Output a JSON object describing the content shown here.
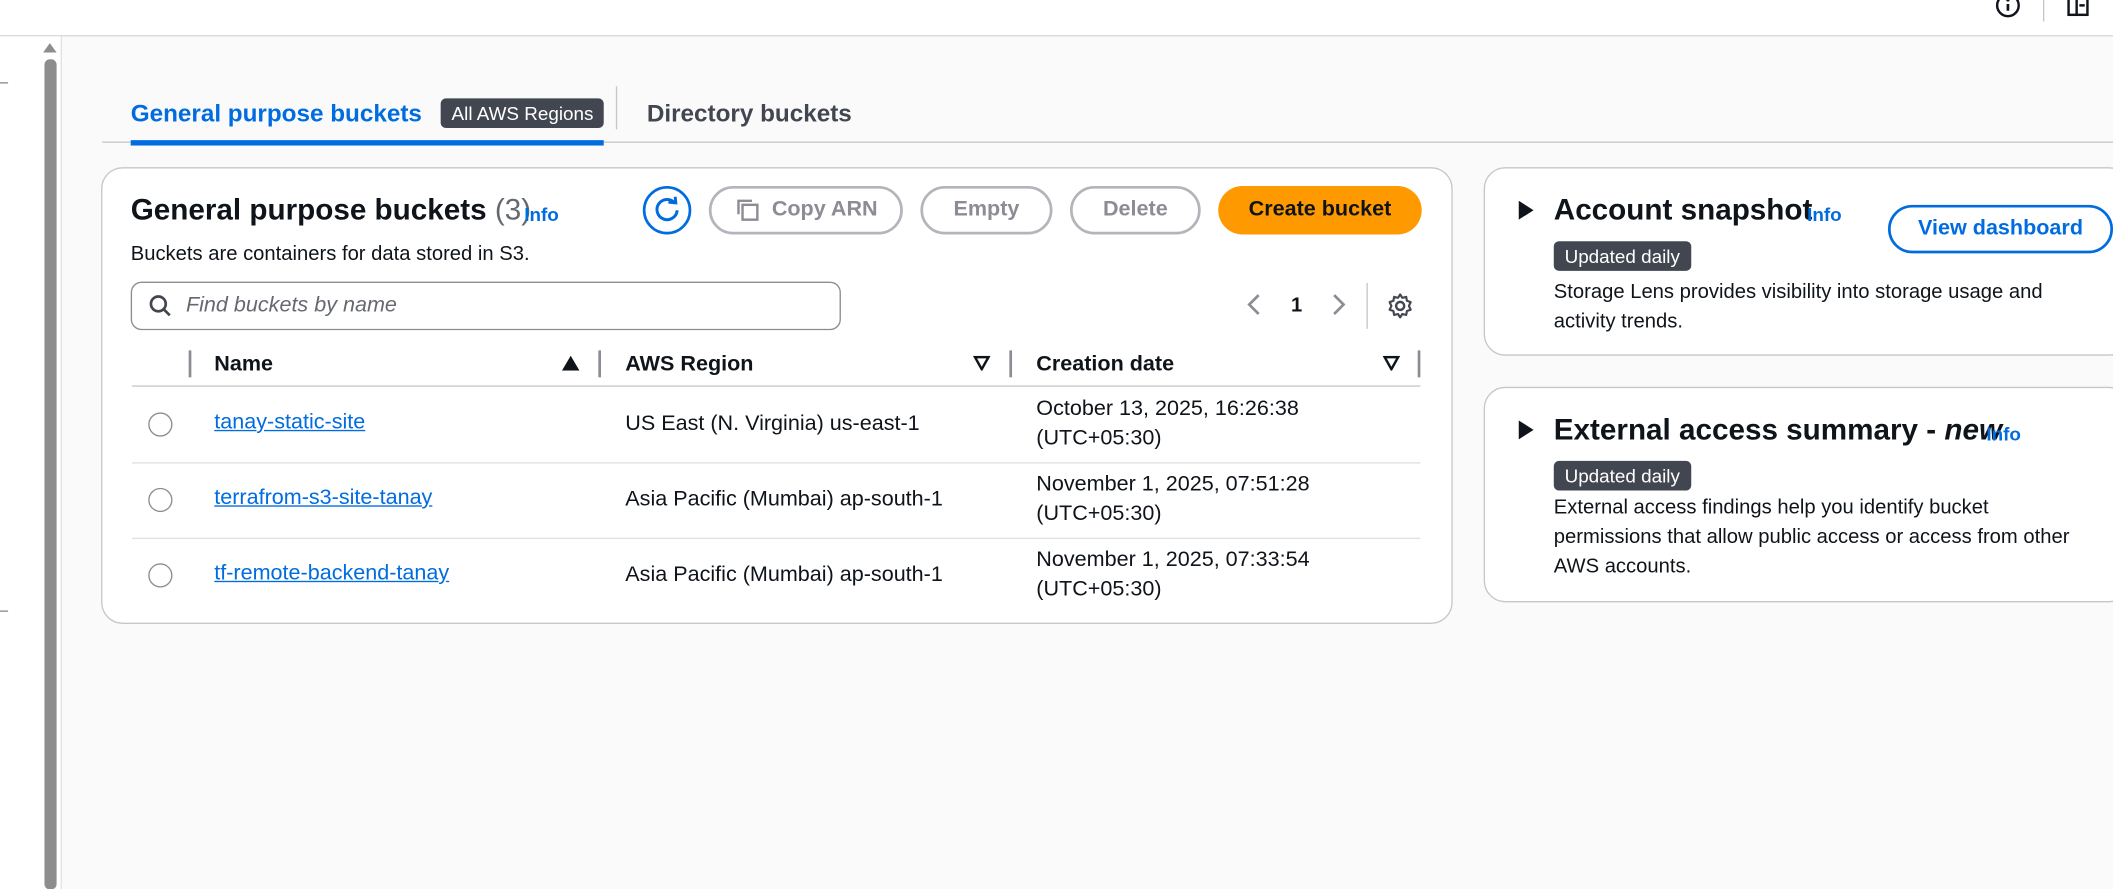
{
  "tabs": {
    "general": "General purpose buckets",
    "regions_badge": "All AWS Regions",
    "directory": "Directory buckets"
  },
  "buckets_panel": {
    "title": "General purpose buckets",
    "count": "(3)",
    "info": "Info",
    "description": "Buckets are containers for data stored in S3.",
    "copy_arn": "Copy ARN",
    "empty": "Empty",
    "delete": "Delete",
    "create": "Create bucket",
    "search_placeholder": "Find buckets by name",
    "page": "1",
    "columns": {
      "name": "Name",
      "region": "AWS Region",
      "created": "Creation date"
    },
    "rows": [
      {
        "name": "tanay-static-site",
        "region": "US East (N. Virginia) us-east-1",
        "created_line1": "October 13, 2025, 16:26:38",
        "created_line2": "(UTC+05:30)"
      },
      {
        "name": "terrafrom-s3-site-tanay",
        "region": "Asia Pacific (Mumbai) ap-south-1",
        "created_line1": "November 1, 2025, 07:51:28",
        "created_line2": "(UTC+05:30)"
      },
      {
        "name": "tf-remote-backend-tanay",
        "region": "Asia Pacific (Mumbai) ap-south-1",
        "created_line1": "November 1, 2025, 07:33:54",
        "created_line2": "(UTC+05:30)"
      }
    ]
  },
  "snapshot": {
    "title": "Account snapshot",
    "info": "Info",
    "badge": "Updated daily",
    "button": "View dashboard",
    "text_line1": "Storage Lens provides visibility into storage usage and",
    "text_line2": "activity trends."
  },
  "external": {
    "title_main": "External access summary - ",
    "title_new": "new",
    "info": "Info",
    "badge": "Updated daily",
    "text_line1": "External access findings help you identify bucket",
    "text_line2": "permissions that allow public access or access from other",
    "text_line3": "AWS accounts."
  },
  "icons": {
    "topbar": [
      "info-circle-icon",
      "panel-icon"
    ],
    "toolbar": [
      "refresh-icon",
      "copy-icon",
      "search-icon",
      "chevron-left-icon",
      "chevron-right-icon",
      "gear-icon"
    ]
  },
  "colors": {
    "accent": "#006ce0",
    "primary_button": "#ff9900",
    "badge_bg": "#424650"
  }
}
